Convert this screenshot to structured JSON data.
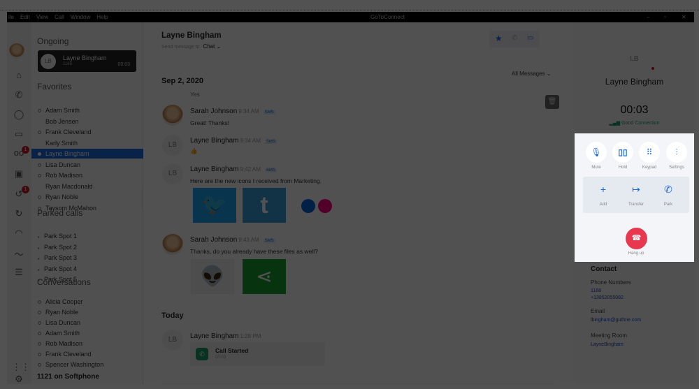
{
  "app": {
    "title": "GoToConnect",
    "menu": [
      "ile",
      "Edit",
      "View",
      "Call",
      "Window",
      "Help"
    ]
  },
  "rail": {
    "badges": {
      "voicemail": "1",
      "history": "1"
    }
  },
  "sidebar": {
    "ongoing_title": "Ongoing",
    "ongoing_call": {
      "initials": "LB",
      "name": "Layne Bingham",
      "ext": "1168",
      "duration": "00:03"
    },
    "favorites_title": "Favorites",
    "favorites": [
      {
        "name": "Adam Smith",
        "dot": true
      },
      {
        "name": "Bob Jensen",
        "dot": false
      },
      {
        "name": "Frank Cleveland",
        "dot": true
      },
      {
        "name": "Karly Smith",
        "dot": false
      },
      {
        "name": "Layne Bingham",
        "dot": true,
        "selected": true
      },
      {
        "name": "Lisa Duncan",
        "dot": true
      },
      {
        "name": "Rob Madison",
        "dot": true
      },
      {
        "name": "Ryan Macdonald",
        "dot": false
      },
      {
        "name": "Ryan Noble",
        "dot": true
      },
      {
        "name": "Taysom McMahon",
        "dot": true
      }
    ],
    "parked_title": "Parked calls",
    "parked": [
      "Park Spot 1",
      "Park Spot 2",
      "Park Spot 3",
      "Park Spot 4",
      "Park Spot 5"
    ],
    "conversations_title": "Conversations",
    "conversations": [
      "Alicia Cooper",
      "Ryan Noble",
      "Lisa Duncan",
      "Adam Smith",
      "Rob Madison",
      "Frank Cleveland",
      "Spencer Washington"
    ],
    "footer": "1121 on Softphone"
  },
  "chat": {
    "contact": "Layne Bingham",
    "send_to_label": "Send message to",
    "send_to_value": "Chat",
    "filter": "All Messages",
    "date1": "Sep 2, 2020",
    "prev_text": "Yes",
    "messages": [
      {
        "sender": "Sarah Johnson",
        "time": "9:34 AM",
        "tag": "SMS",
        "text": "Great! Thanks!"
      },
      {
        "sender": "Layne Bingham",
        "initials": "LB",
        "time": "9:34 AM",
        "tag": "SMS",
        "text": "👍"
      },
      {
        "sender": "Layne Bingham",
        "initials": "LB",
        "time": "9:42 AM",
        "tag": "SMS",
        "text": "Here are the new icons I received from Marketing."
      },
      {
        "sender": "Sarah Johnson",
        "time": "9:43 AM",
        "tag": "SMS",
        "text": "Thanks, do you already have these files as well?"
      }
    ],
    "date2": "Today",
    "call_msg": {
      "sender": "Layne Bingham",
      "initials": "LB",
      "time": "1:28 PM",
      "title": "Call Started",
      "duration": "00:03"
    }
  },
  "call": {
    "initials": "LB",
    "name": "Layne Bingham",
    "timer": "00:03",
    "quality": "Good Connection",
    "controls": [
      "Mute",
      "Hold",
      "Keypad",
      "Settings"
    ],
    "actions": [
      "Add",
      "Transfer",
      "Park"
    ],
    "hangup": "Hang up"
  },
  "contact": {
    "title": "Contact",
    "phones_label": "Phone Numbers",
    "phones": [
      "1168",
      "+13852055082"
    ],
    "email_label": "Email",
    "email": "lbingham@guthrie.com",
    "room_label": "Meeting Room",
    "room": "LayneBingham"
  },
  "colors": {
    "accent": "#1a6ae0",
    "hangup": "#e8384f",
    "badge": "#d0182a",
    "call_green": "#1f9d6b"
  }
}
